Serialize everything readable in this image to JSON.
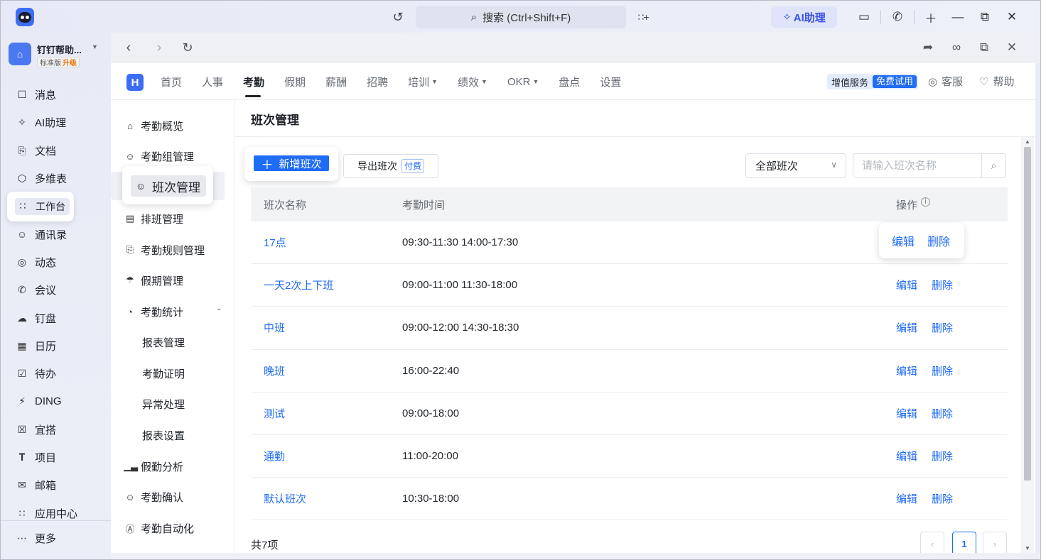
{
  "titlebar": {
    "search_placeholder": "搜索 (Ctrl+Shift+F)",
    "ai_button": "AI助理"
  },
  "org": {
    "name": "钉钉帮助...",
    "edition": "标准版",
    "upgrade": "升级"
  },
  "sidebar": {
    "items": [
      {
        "label": "消息",
        "icon": "message-icon"
      },
      {
        "label": "AI助理",
        "icon": "ai-icon"
      },
      {
        "label": "文档",
        "icon": "doc-icon"
      },
      {
        "label": "多维表",
        "icon": "table-icon"
      },
      {
        "label": "工作台",
        "icon": "workbench-icon"
      },
      {
        "label": "通讯录",
        "icon": "contacts-icon"
      },
      {
        "label": "动态",
        "icon": "feed-icon"
      },
      {
        "label": "会议",
        "icon": "meeting-icon"
      },
      {
        "label": "钉盘",
        "icon": "cloud-icon"
      },
      {
        "label": "日历",
        "icon": "calendar-icon"
      },
      {
        "label": "待办",
        "icon": "todo-icon"
      },
      {
        "label": "DING",
        "icon": "ding-icon"
      },
      {
        "label": "宜搭",
        "icon": "yida-icon"
      },
      {
        "label": "项目",
        "icon": "project-icon"
      },
      {
        "label": "邮箱",
        "icon": "mail-icon"
      },
      {
        "label": "应用中心",
        "icon": "app-center-icon"
      }
    ],
    "more": "更多"
  },
  "topnav": {
    "tabs": [
      {
        "label": "首页"
      },
      {
        "label": "人事"
      },
      {
        "label": "考勤"
      },
      {
        "label": "假期"
      },
      {
        "label": "薪酬"
      },
      {
        "label": "招聘"
      },
      {
        "label": "培训"
      },
      {
        "label": "绩效"
      },
      {
        "label": "OKR"
      },
      {
        "label": "盘点"
      },
      {
        "label": "设置"
      }
    ],
    "service": "增值服务",
    "free_trial": "免费试用",
    "support": "客服",
    "help": "帮助"
  },
  "submenu": {
    "items": [
      {
        "label": "考勤概览"
      },
      {
        "label": "考勤组管理"
      },
      {
        "label": "班次管理"
      },
      {
        "label": "排班管理"
      },
      {
        "label": "考勤规则管理"
      },
      {
        "label": "假期管理"
      },
      {
        "label": "考勤统计"
      },
      {
        "label": "报表管理"
      },
      {
        "label": "考勤证明"
      },
      {
        "label": "异常处理"
      },
      {
        "label": "报表设置"
      },
      {
        "label": "假勤分析"
      },
      {
        "label": "考勤确认"
      },
      {
        "label": "考勤自动化"
      }
    ]
  },
  "main": {
    "title": "班次管理",
    "add_button": "新增班次",
    "export_button": "导出班次",
    "paid_tag": "付费",
    "filter_value": "全部班次",
    "search_placeholder": "请输入班次名称",
    "columns": {
      "name": "班次名称",
      "time": "考勤时间",
      "ops": "操作"
    },
    "rows": [
      {
        "name": "17点",
        "time": "09:30-11:30 14:00-17:30"
      },
      {
        "name": "一天2次上下班",
        "time": "09:00-11:00 11:30-18:00"
      },
      {
        "name": "中班",
        "time": "09:00-12:00 14:30-18:30"
      },
      {
        "name": "晚班",
        "time": "16:00-22:40"
      },
      {
        "name": "测试",
        "time": "09:00-18:00"
      },
      {
        "name": "通勤",
        "time": "11:00-20:00"
      },
      {
        "name": "默认班次",
        "time": "10:30-18:00"
      }
    ],
    "edit_label": "编辑",
    "delete_label": "删除",
    "total": "共7项",
    "current_page": "1"
  },
  "colors": {
    "accent": "#1f6cf5",
    "ai": "#3a52e6"
  }
}
